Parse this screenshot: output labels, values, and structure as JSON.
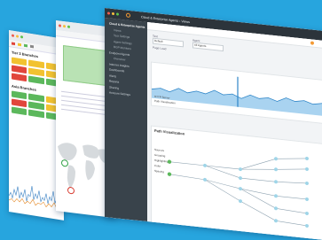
{
  "background_color": "#27a5de",
  "window_left": {
    "sections": [
      {
        "title": "Tier 3 Branches",
        "tiles": [
          "#f2c230",
          "#f2c230",
          "#f2c230",
          "#e1463b",
          "#f2c230",
          "#f2c230",
          "#e1463b",
          "#5cb85c",
          "#5cb85c"
        ]
      },
      {
        "title": "Asia Branches",
        "tiles": [
          "#5cb85c",
          "#5cb85c",
          "#f2c230",
          "#e1463b",
          "#5cb85c",
          "#f2c230",
          "#5cb85c",
          "#5cb85c",
          "#5cb85c"
        ]
      }
    ],
    "status_colors": {
      "green": "#5cb85c",
      "yellow": "#f2c230",
      "red": "#e1463b"
    }
  },
  "window_mid": {
    "map_markers": [
      {
        "icon": "map-marker-green-icon",
        "color": "#2ea043"
      },
      {
        "icon": "map-marker-red-icon",
        "color": "#d73a2f"
      }
    ]
  },
  "window_main": {
    "title": "Cloud & Enterprise Agents  ›  Views",
    "sidebar": [
      {
        "label": "Cloud & Enterprise Agents",
        "type": "hdr"
      },
      {
        "label": "Views",
        "type": "sub"
      },
      {
        "label": "Test Settings",
        "type": "sub"
      },
      {
        "label": "Agent Settings",
        "type": "sub"
      },
      {
        "label": "BGP Monitors",
        "type": "sub"
      },
      {
        "label": "Endpoint Agents",
        "type": "item"
      },
      {
        "label": "Overview",
        "type": "sub"
      },
      {
        "label": "Internet Insights",
        "type": "item"
      },
      {
        "label": "Dashboards",
        "type": "item"
      },
      {
        "label": "Alerts",
        "type": "item"
      },
      {
        "label": "Reports",
        "type": "item"
      },
      {
        "label": "Sharing",
        "type": "item"
      },
      {
        "label": "Account Settings",
        "type": "item"
      }
    ],
    "fields": [
      {
        "label": "Test",
        "value": "Default"
      },
      {
        "label": "Agent",
        "value": "All Agents"
      }
    ],
    "layer_labels": [
      "Page Load",
      "HTTP Server",
      "Path Visualization"
    ],
    "path_card_title": "Path Visualization",
    "path_rows": [
      "Sources",
      "Grouping",
      "Highlighting",
      "Color",
      "Spacing"
    ]
  }
}
